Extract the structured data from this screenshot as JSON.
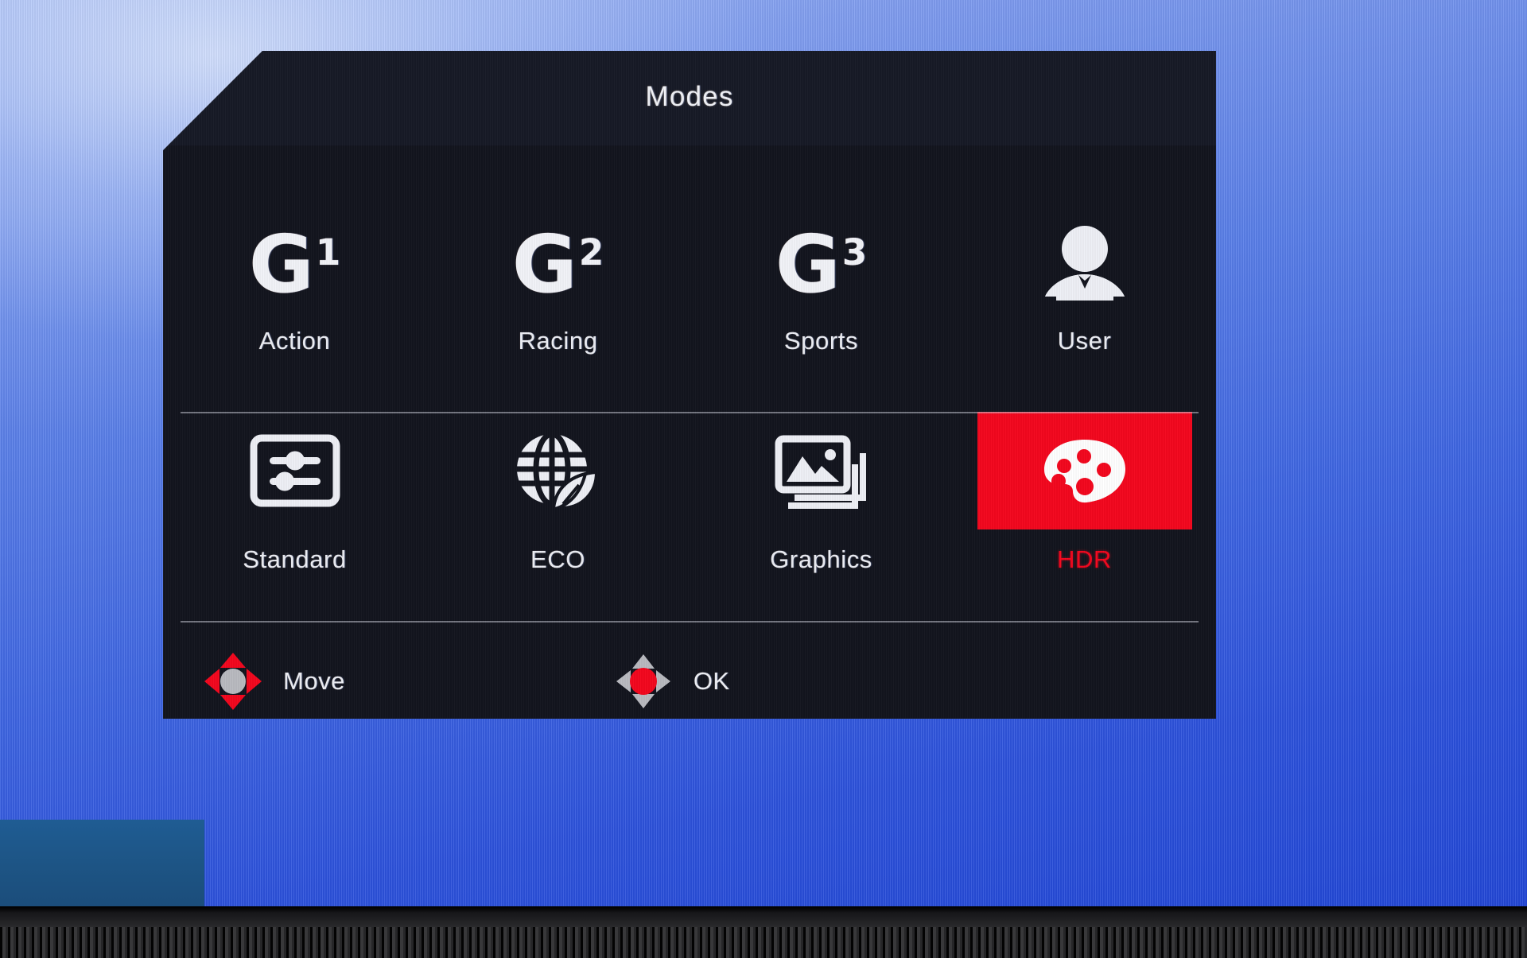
{
  "osd": {
    "title": "Modes",
    "modes_row_1": [
      {
        "label": "Action",
        "icon": "g1-icon",
        "glyph": "G",
        "sup": "1",
        "selected": false
      },
      {
        "label": "Racing",
        "icon": "g2-icon",
        "glyph": "G",
        "sup": "2",
        "selected": false
      },
      {
        "label": "Sports",
        "icon": "g3-icon",
        "glyph": "G",
        "sup": "3",
        "selected": false
      },
      {
        "label": "User",
        "icon": "user-avatar-icon",
        "selected": false
      }
    ],
    "modes_row_2": [
      {
        "label": "Standard",
        "icon": "sliders-icon",
        "selected": false
      },
      {
        "label": "ECO",
        "icon": "globe-leaf-icon",
        "selected": false
      },
      {
        "label": "Graphics",
        "icon": "photo-stack-icon",
        "selected": false
      },
      {
        "label": "HDR",
        "icon": "color-palette-icon",
        "selected": true
      }
    ],
    "footer": [
      {
        "label": "Move",
        "icon": "dpad-move-icon"
      },
      {
        "label": "OK",
        "icon": "dpad-ok-icon"
      }
    ],
    "colors": {
      "panel_background": "#13151e",
      "header_background": "#171a26",
      "text": "#eceef5",
      "highlight_red": "#f4071e",
      "divider": "#cdd0da",
      "dpad_gray": "#b9bac0",
      "desktop_blue": "#3f66e2",
      "taskbar_blue": "#1d5484"
    }
  }
}
